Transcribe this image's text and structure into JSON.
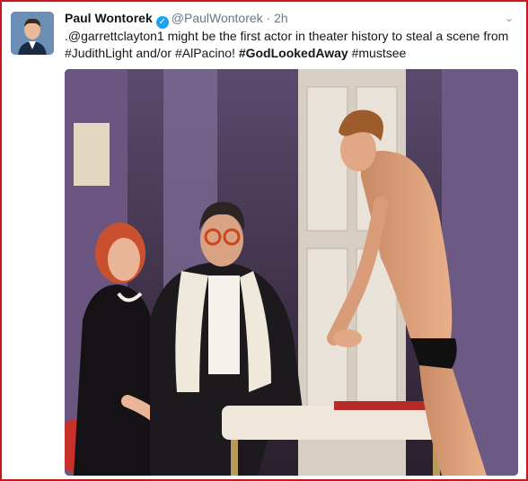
{
  "tweet": {
    "author_name": "Paul Wontorek",
    "handle": "@PaulWontorek",
    "separator": "·",
    "time": "2h",
    "text_part1": ".@garrettclayton1 might be the first actor in theater history to steal a scene from #JudithLight and/or #AlPacino! ",
    "hashtag_bold": "#GodLookedAway",
    "text_part2": " #mustsee"
  },
  "icons": {
    "avatar": "user-avatar",
    "verified": "verified-badge-icon",
    "menu": "chevron-down-icon"
  },
  "colors": {
    "frame_border": "#c8171e",
    "verified": "#1da1f2",
    "meta_text": "#657786"
  }
}
